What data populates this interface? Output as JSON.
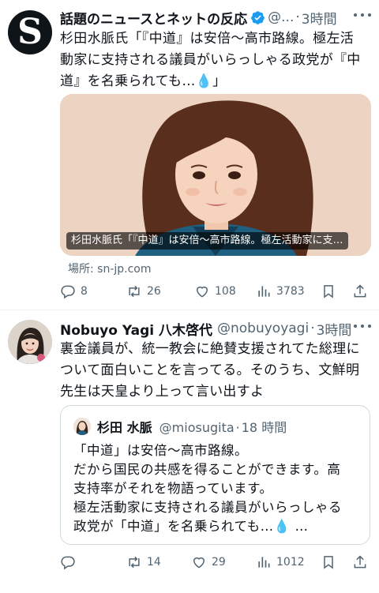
{
  "tweets": [
    {
      "display_name": "話題のニュースとネットの反応",
      "verified": true,
      "handle": "@...",
      "time": "3時間",
      "avatar_letter": "S",
      "text_lines": [
        "杉田水脈氏「『中道』は安倍〜高市路線。極左活",
        "動家に支持される議員がいらっしゃる政党が『中",
        "道』を名乗られても…"
      ],
      "text_end": "」",
      "card": {
        "caption": "杉田水脈氏「『中道』は安倍〜高市路線。極左活動家に支…",
        "source_label": "場所: sn-jp.com"
      },
      "stats": {
        "replies": "8",
        "retweets": "26",
        "likes": "108",
        "views": "3783"
      }
    },
    {
      "display_name": "Nobuyo Yagi 八木啓代",
      "handle": "@nobuyoyagi",
      "time": "3時間",
      "text_lines": [
        "裏金議員が、統一教会に絶賛支援されてた総理に",
        "ついて面白いことを言ってる。そのうち、文鮮明",
        "先生は天皇より上って言い出すよ"
      ],
      "quote": {
        "display_name": "杉田 水脈",
        "handle": "@miosugita",
        "time": "18 時間",
        "text_lines": [
          "「中道」は安倍〜高市路線。",
          "だから国民の共感を得ることができます。高",
          "支持率がそれを物語っています。",
          "極左活動家に支持される議員がいらっしゃる",
          "政党が「中道」を名乗られても…"
        ],
        "text_end": " …"
      },
      "stats": {
        "replies": "",
        "retweets": "14",
        "likes": "29",
        "views": "1012"
      }
    }
  ],
  "dot_separator": "·",
  "colors": {
    "text": "#0f1419",
    "secondary": "#536471",
    "verified": "#1d9bf0",
    "border": "#cfd9de",
    "drop": "#2f9de6"
  },
  "icons": [
    "reply-icon",
    "retweet-icon",
    "like-icon",
    "views-icon",
    "bookmark-icon",
    "share-icon",
    "more-icon",
    "verified-badge-icon",
    "droplet-emoji"
  ]
}
